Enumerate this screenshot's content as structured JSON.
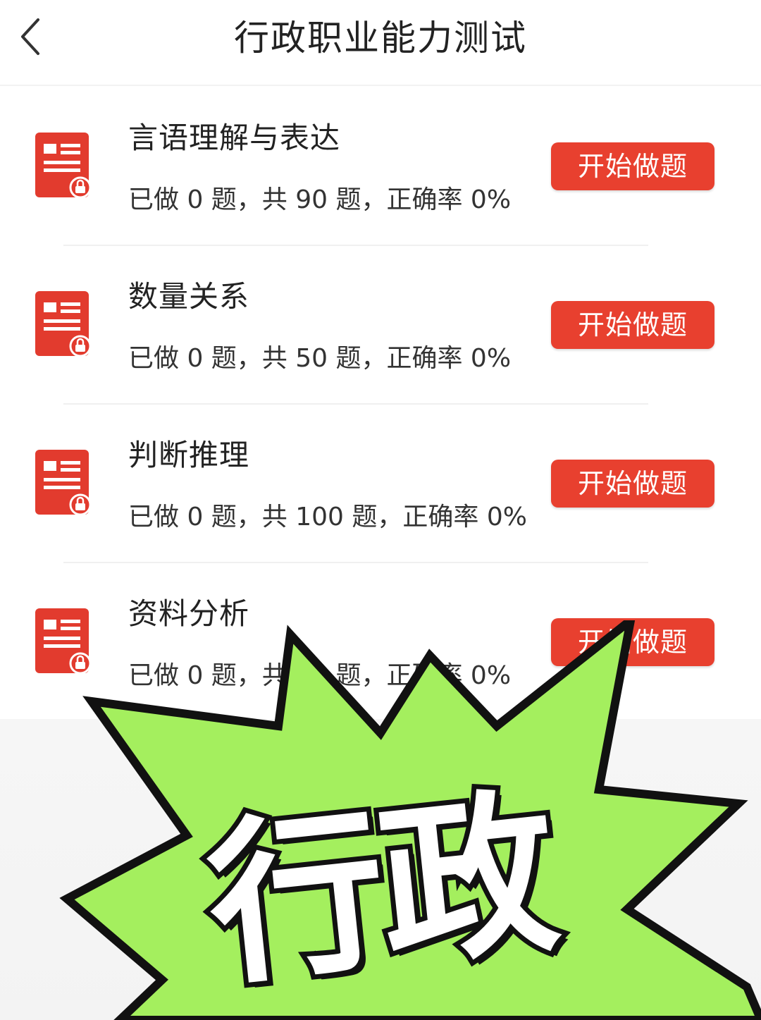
{
  "header": {
    "title": "行政职业能力测试",
    "back_icon": "chevron-left-icon"
  },
  "colors": {
    "accent": "#e8402f",
    "sticker_fill": "#a4ef5e",
    "sticker_outline": "#111111"
  },
  "sections": [
    {
      "name": "言语理解与表达",
      "stats": "已做 0 题，共 90 题，正确率 0%",
      "button_label": "开始做题",
      "icon": "document-lock-icon"
    },
    {
      "name": "数量关系",
      "stats": "已做 0 题，共 50 题，正确率 0%",
      "button_label": "开始做题",
      "icon": "document-lock-icon"
    },
    {
      "name": "判断推理",
      "stats": "已做 0 题，共 100 题，正确率 0%",
      "button_label": "开始做题",
      "icon": "document-lock-icon"
    },
    {
      "name": "资料分析",
      "stats": "已做 0 题，共 90 题，正确率 0%",
      "button_label": "开始做题",
      "icon": "document-lock-icon"
    }
  ],
  "sticker": {
    "text": "行政"
  }
}
